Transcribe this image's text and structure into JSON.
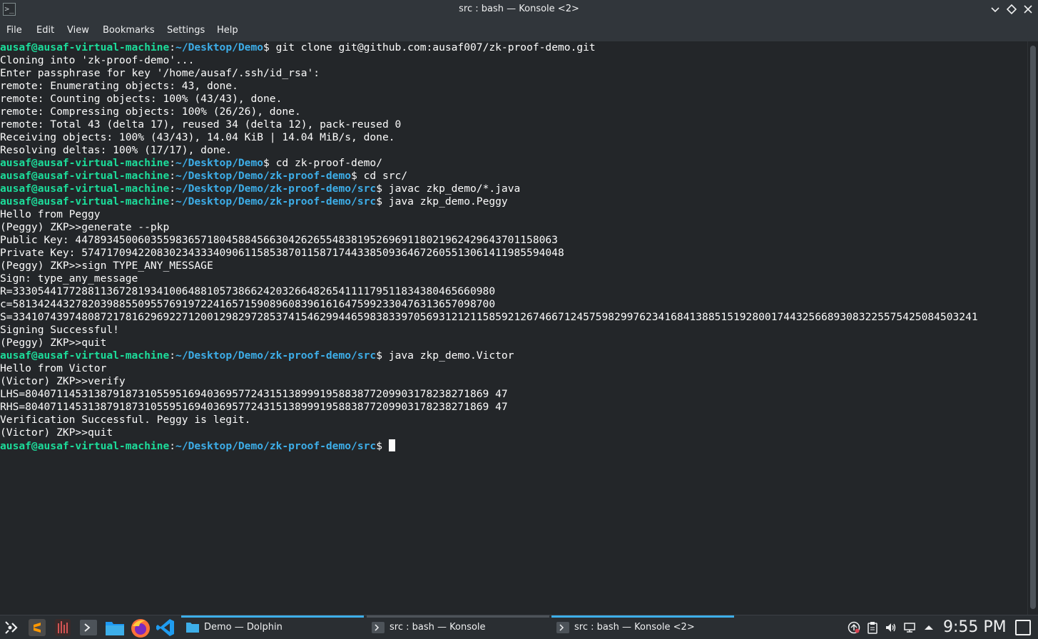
{
  "window": {
    "title": "src : bash — Konsole <2>"
  },
  "menubar": {
    "items": [
      "File",
      "Edit",
      "View",
      "Bookmarks",
      "Settings",
      "Help"
    ]
  },
  "prompt": {
    "user": "ausaf@ausaf-virtual-machine",
    "colon": ":",
    "dollar": "$ "
  },
  "terminal": {
    "lines": [
      {
        "type": "prompt",
        "path": "~/Desktop/Demo",
        "cmd": "git clone git@github.com:ausaf007/zk-proof-demo.git"
      },
      {
        "type": "out",
        "text": "Cloning into 'zk-proof-demo'..."
      },
      {
        "type": "out",
        "text": "Enter passphrase for key '/home/ausaf/.ssh/id_rsa':"
      },
      {
        "type": "out",
        "text": "remote: Enumerating objects: 43, done."
      },
      {
        "type": "out",
        "text": "remote: Counting objects: 100% (43/43), done."
      },
      {
        "type": "out",
        "text": "remote: Compressing objects: 100% (26/26), done."
      },
      {
        "type": "out",
        "text": "remote: Total 43 (delta 17), reused 34 (delta 12), pack-reused 0"
      },
      {
        "type": "out",
        "text": "Receiving objects: 100% (43/43), 14.04 KiB | 14.04 MiB/s, done."
      },
      {
        "type": "out",
        "text": "Resolving deltas: 100% (17/17), done."
      },
      {
        "type": "prompt",
        "path": "~/Desktop/Demo",
        "cmd": "cd zk-proof-demo/"
      },
      {
        "type": "prompt",
        "path": "~/Desktop/Demo/zk-proof-demo",
        "cmd": "cd src/"
      },
      {
        "type": "prompt",
        "path": "~/Desktop/Demo/zk-proof-demo/src",
        "cmd": "javac zkp_demo/*.java"
      },
      {
        "type": "prompt",
        "path": "~/Desktop/Demo/zk-proof-demo/src",
        "cmd": "java zkp_demo.Peggy"
      },
      {
        "type": "out",
        "text": "Hello from Peggy"
      },
      {
        "type": "out",
        "text": "(Peggy) ZKP>>generate --pkp"
      },
      {
        "type": "out",
        "text": "Public Key: 44789345006035598365718045884566304262655483819526969118021962429643701158063"
      },
      {
        "type": "out",
        "text": "Private Key: 57471709422083023433340906115853870115871744338509364672605513061411985594048"
      },
      {
        "type": "out",
        "text": "(Peggy) ZKP>>sign TYPE_ANY_MESSAGE"
      },
      {
        "type": "out",
        "text": "Sign: type_any_message"
      },
      {
        "type": "out",
        "text": "R=33305441772881136728193410064881057386624203266482654111179511834380465660980"
      },
      {
        "type": "out",
        "text": "c=58134244327820398855095576919722416571590896083961616475992330476313657098700"
      },
      {
        "type": "out",
        "text": "S=3341074397480872178162969227120012982972853741546299446598383397056931212115859212674667124575982997623416841388515192800174432566893083225575425084503241"
      },
      {
        "type": "out",
        "text": "Signing Successful!"
      },
      {
        "type": "out",
        "text": "(Peggy) ZKP>>quit"
      },
      {
        "type": "prompt",
        "path": "~/Desktop/Demo/zk-proof-demo/src",
        "cmd": "java zkp_demo.Victor"
      },
      {
        "type": "out",
        "text": "Hello from Victor"
      },
      {
        "type": "out",
        "text": "(Victor) ZKP>>verify"
      },
      {
        "type": "out",
        "text": "LHS=80407114531387918731055951694036957724315138999195883877209903178238271869 47"
      },
      {
        "type": "out",
        "text": "RHS=80407114531387918731055951694036957724315138999195883877209903178238271869 47"
      },
      {
        "type": "out",
        "text": "Verification Successful. Peggy is legit."
      },
      {
        "type": "out",
        "text": "(Victor) ZKP>>quit"
      },
      {
        "type": "prompt",
        "path": "~/Desktop/Demo/zk-proof-demo/src",
        "cmd": "",
        "cursor": true
      }
    ]
  },
  "taskbar": {
    "launchers": [
      "application-launcher-icon",
      "sublime-text-icon",
      "system-monitor-icon",
      "terminal-icon",
      "file-manager-icon",
      "firefox-icon",
      "vscode-icon"
    ],
    "tasks": [
      {
        "label": "Demo — Dolphin",
        "icon": "folder-icon",
        "active": false
      },
      {
        "label": "src : bash — Konsole",
        "icon": "terminal-icon",
        "active": false
      },
      {
        "label": "src : bash — Konsole <2>",
        "icon": "terminal-icon",
        "active": true
      }
    ],
    "tray": [
      "update-icon",
      "clipboard-icon",
      "volume-icon",
      "network-icon",
      "expand-tray-icon"
    ],
    "clock": "9:55 PM"
  },
  "colors": {
    "prompt_user": "#1cdc9a",
    "prompt_path": "#3daee9",
    "task_highlight": "#3daee9",
    "background": "#232629"
  }
}
